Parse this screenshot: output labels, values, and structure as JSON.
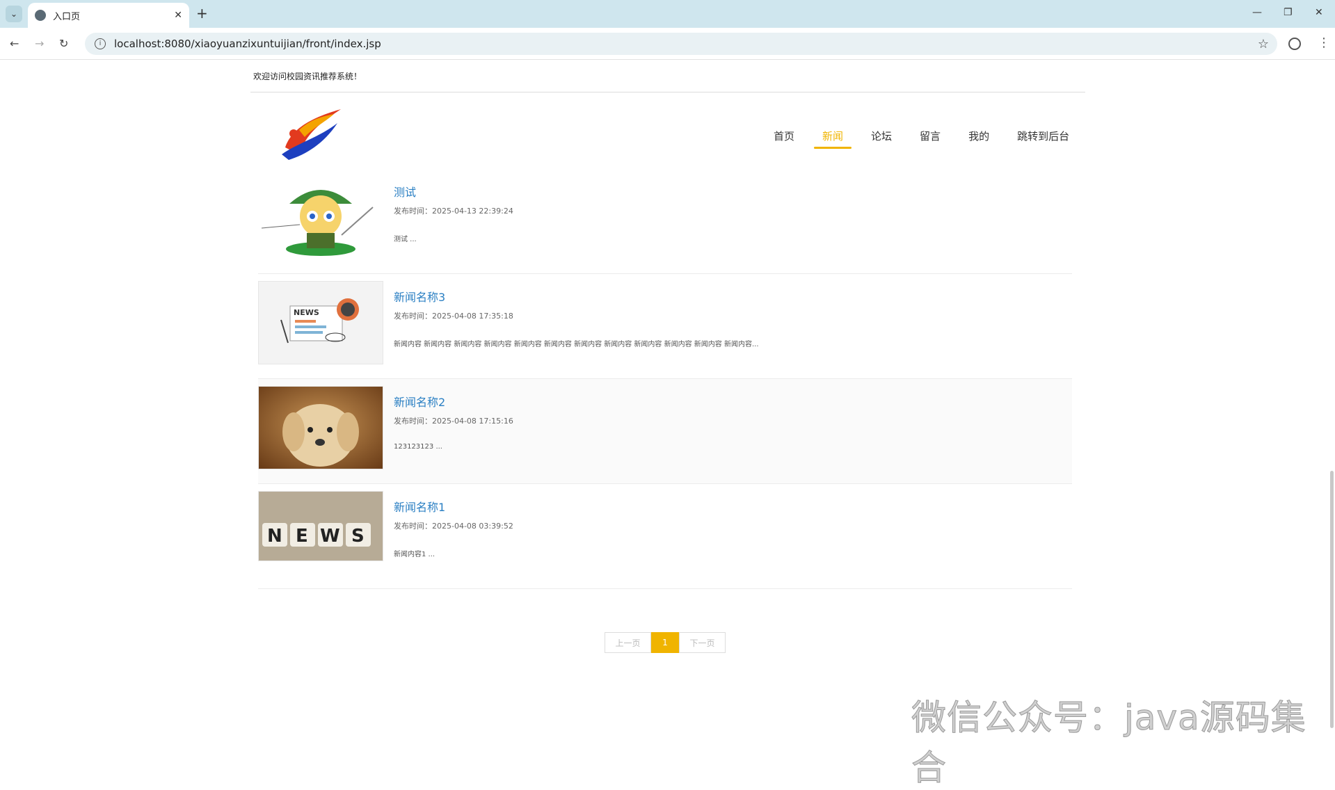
{
  "browser": {
    "tab_title": "入口页",
    "url": "localhost:8080/xiaoyuanzixuntuijian/front/index.jsp"
  },
  "site": {
    "welcome": "欢迎访问校园资讯推荐系统！"
  },
  "nav": {
    "items": [
      {
        "label": "首页",
        "active": false
      },
      {
        "label": "新闻",
        "active": true
      },
      {
        "label": "论坛",
        "active": false
      },
      {
        "label": "留言",
        "active": false
      },
      {
        "label": "我的",
        "active": false
      },
      {
        "label": "跳转到后台",
        "active": false
      }
    ]
  },
  "news": [
    {
      "title": "测试",
      "time": "发布时间：2025-04-13 22:39:24",
      "desc": "测试 ..."
    },
    {
      "title": "新闻名称3",
      "time": "发布时间：2025-04-08 17:35:18",
      "desc": "新闻内容 新闻内容 新闻内容 新闻内容 新闻内容 新闻内容 新闻内容 新闻内容 新闻内容 新闻内容 新闻内容 新闻内容..."
    },
    {
      "title": "新闻名称2",
      "time": "发布时间：2025-04-08 17:15:16",
      "desc": "123123123 ..."
    },
    {
      "title": "新闻名称1",
      "time": "发布时间：2025-04-08 03:39:52",
      "desc": "新闻内容1 ..."
    }
  ],
  "pager": {
    "prev": "上一页",
    "current": "1",
    "next": "下一页"
  },
  "watermark": "微信公众号：java源码集合",
  "colors": {
    "accent": "#f0b400",
    "link": "#2a7fc3"
  }
}
